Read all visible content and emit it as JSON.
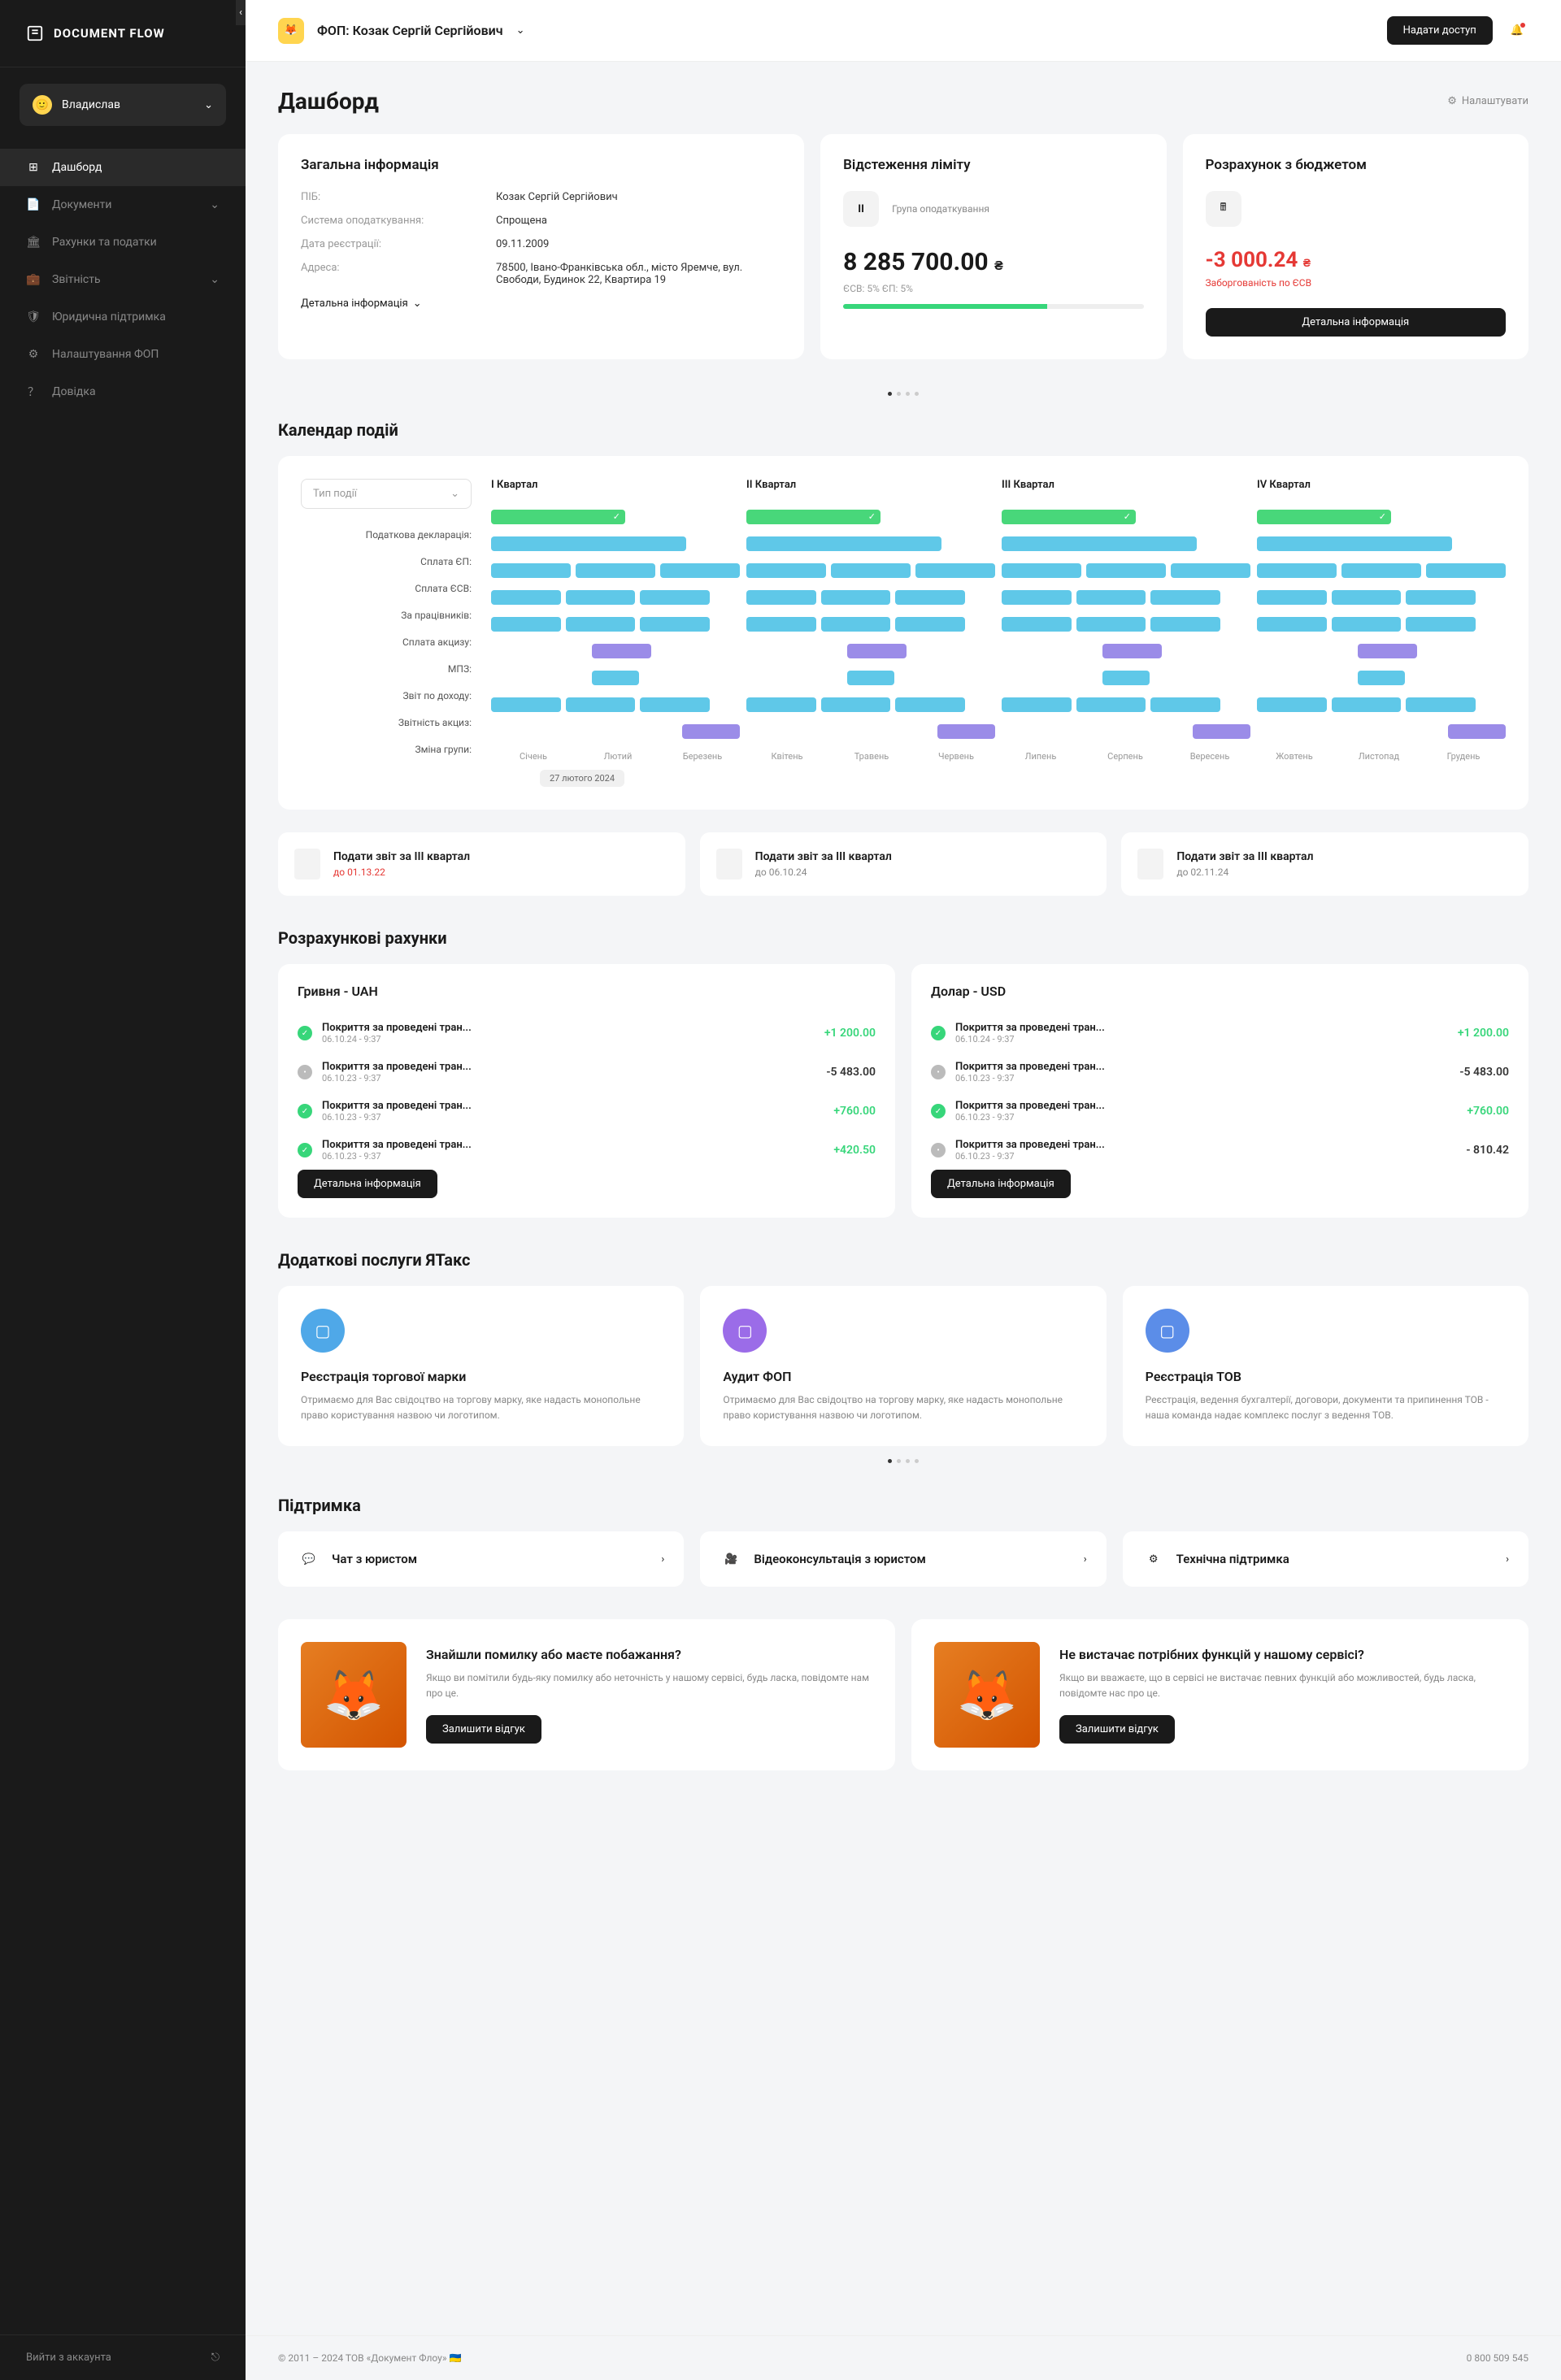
{
  "brand": "DOCUMENT FLOW",
  "user": "Владислав",
  "nav": {
    "dashboard": "Дашборд",
    "documents": "Документи",
    "invoices": "Рахунки та податки",
    "reports": "Звітність",
    "legal": "Юридична підтримка",
    "settings": "Налаштування ФОП",
    "help": "Довідка",
    "logout": "Вийти з аккаунта"
  },
  "topbar": {
    "title": "ФОП: Козак Сергій Сергійович",
    "access": "Надати доступ"
  },
  "page": {
    "title": "Дашборд",
    "settings": "Налаштувати"
  },
  "general": {
    "title": "Загальна інформація",
    "rows": {
      "name_l": "ПІБ:",
      "name_v": "Козак Сергій Сергійович",
      "tax_l": "Система оподаткування:",
      "tax_v": "Спрощена",
      "date_l": "Дата реєстрації:",
      "date_v": "09.11.2009",
      "addr_l": "Адреса:",
      "addr_v": "78500, Івано-Франківська обл., місто Яремче, вул. Свободи, Будинок 22, Квартира 19"
    },
    "more": "Детальна інформація"
  },
  "limit": {
    "title": "Відстеження ліміту",
    "group": "Група оподаткування",
    "amount": "8 285 700.00",
    "curr": "₴",
    "pct": "ЄСВ: 5%   ЄП: 5%"
  },
  "budget": {
    "title": "Розрахунок з бюджетом",
    "amount": "-3 000.24",
    "curr": "₴",
    "sub": "Заборгованість по ЄСВ",
    "more": "Детальна інформація"
  },
  "calendar": {
    "title": "Календар подій",
    "type": "Тип події",
    "quarters": [
      "I Квартал",
      "II Квартал",
      "III Квартал",
      "IV Квартал"
    ],
    "rows": [
      "Податкова декларація:",
      "Сплата ЄП:",
      "Сплата ЄСВ:",
      "За працівників:",
      "Сплата акцизу:",
      "МПЗ:",
      "Звіт по доходу:",
      "Звітність акциз:",
      "Зміна групи:"
    ],
    "months": [
      "Січень",
      "Лютий",
      "Березень",
      "Квітень",
      "Травень",
      "Червень",
      "Липень",
      "Серпень",
      "Вересень",
      "Жовтень",
      "Листопад",
      "Грудень"
    ],
    "today": "27 лютого 2024"
  },
  "reports": [
    {
      "title": "Подати звіт за III квартал",
      "date": "до 01.13.22",
      "red": true
    },
    {
      "title": "Подати звіт за III квартал",
      "date": "до 06.10.24",
      "red": false
    },
    {
      "title": "Подати звіт за III квартал",
      "date": "до 02.11.24",
      "red": false
    }
  ],
  "accounts": {
    "title": "Розрахункові рахунки",
    "a": {
      "name": "Гривня - UAH",
      "tx": [
        {
          "t": "Покриття за проведені тран...",
          "d": "06.10.24 - 9:37",
          "a": "+1 200.00",
          "pos": true,
          "g": true
        },
        {
          "t": "Покриття за проведені тран...",
          "d": "06.10.23 - 9:37",
          "a": "-5 483.00",
          "pos": false,
          "g": false
        },
        {
          "t": "Покриття за проведені тран...",
          "d": "06.10.23 - 9:37",
          "a": "+760.00",
          "pos": true,
          "g": true
        },
        {
          "t": "Покриття за проведені тран...",
          "d": "06.10.23 - 9:37",
          "a": "+420.50",
          "pos": true,
          "g": true
        }
      ],
      "more": "Детальна інформація"
    },
    "b": {
      "name": "Долар - USD",
      "tx": [
        {
          "t": "Покриття за проведені тран...",
          "d": "06.10.24 - 9:37",
          "a": "+1 200.00",
          "pos": true,
          "g": true
        },
        {
          "t": "Покриття за проведені тран...",
          "d": "06.10.23 - 9:37",
          "a": "-5 483.00",
          "pos": false,
          "g": false
        },
        {
          "t": "Покриття за проведені тран...",
          "d": "06.10.23 - 9:37",
          "a": "+760.00",
          "pos": true,
          "g": true
        },
        {
          "t": "Покриття за проведені тран...",
          "d": "06.10.23 - 9:37",
          "a": "- 810.42",
          "pos": false,
          "g": false
        }
      ],
      "more": "Детальна інформація"
    }
  },
  "services": {
    "title": "Додаткові послуги ЯТакс",
    "items": [
      {
        "title": "Реєстрація торгової марки",
        "desc": "Отримаємо для Вас свідоцтво на торгову марку, яке надасть монопольне право користування назвою чи логотипом."
      },
      {
        "title": "Аудит ФОП",
        "desc": "Отримаємо для Вас свідоцтво на торгову марку, яке надасть монопольне право користування назвою чи логотипом."
      },
      {
        "title": "Реєстрація ТОВ",
        "desc": "Реєстрація, ведення бухгалтерії, договори, документи та припинення ТОВ - наша команда надає комплекс послуг з ведення ТОВ."
      }
    ]
  },
  "support": {
    "title": "Підтримка",
    "items": [
      "Чат з юристом",
      "Відеоконсультація з юристом",
      "Технічна підтримка"
    ]
  },
  "feedback": {
    "a": {
      "title": "Знайшли помилку або маєте побажання?",
      "desc": "Якщо ви помітили будь-яку помилку або неточність у нашому сервісі, будь ласка, повідомте нам про це.",
      "btn": "Залишити відгук"
    },
    "b": {
      "title": "Не вистачає потрібних функцій у нашому сервісі?",
      "desc": "Якщо ви вважаєте, що в сервісі не вистачає певних функцій або можливостей, будь ласка, повідомте нас про це.",
      "btn": "Залишити відгук"
    }
  },
  "footer": {
    "copy": "© 2011 – 2024 ТОВ «Документ Флоу» 🇺🇦",
    "phone": "0 800 509 545"
  }
}
